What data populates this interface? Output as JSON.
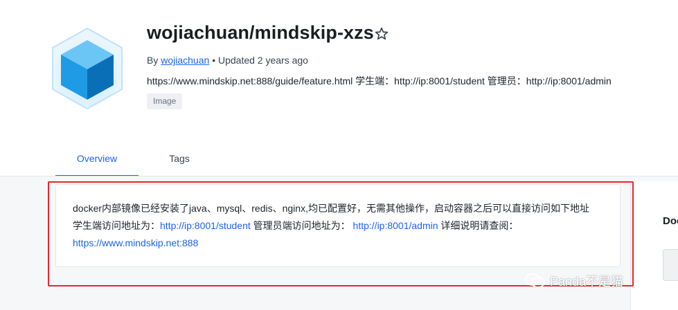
{
  "repo": {
    "name": "wojiachuan/mindskip-xzs",
    "by_label": "By",
    "author": "wojiachuan",
    "updated": "• Updated 2 years ago",
    "description": "https://www.mindskip.net:888/guide/feature.html 学生端：http://ip:8001/student 管理员：http://ip:8001/admin",
    "badge": "Image"
  },
  "tabs": [
    {
      "label": "Overview",
      "active": true
    },
    {
      "label": "Tags",
      "active": false
    }
  ],
  "overview": {
    "line1": "docker内部镜像已经安装了java、mysql、redis、nginx,均已配置好，无需其他操作，启动容器之后可以直接访问如下地址",
    "line2_prefix": "学生端访问地址为：",
    "student_url": "http://ip:8001/student",
    "line2_mid": " 管理员端访问地址为：",
    "admin_url": "http://ip:8001/admin",
    "line2_suffix": " 详细说明请查阅：",
    "site_url": "https://www.mindskip.net:888"
  },
  "sidebar": {
    "title": "Doc"
  },
  "watermark": {
    "text": "Panda不是猫"
  },
  "colors": {
    "accent": "#1d63ed",
    "highlight_border": "#e8262a",
    "cube_top": "#6cc6f5",
    "cube_left": "#1e9be4",
    "cube_right": "#0b6fb8"
  },
  "icons": {
    "logo": "docker-image-cube-icon",
    "star": "star-outline-icon",
    "watermark": "wechat-icon"
  }
}
